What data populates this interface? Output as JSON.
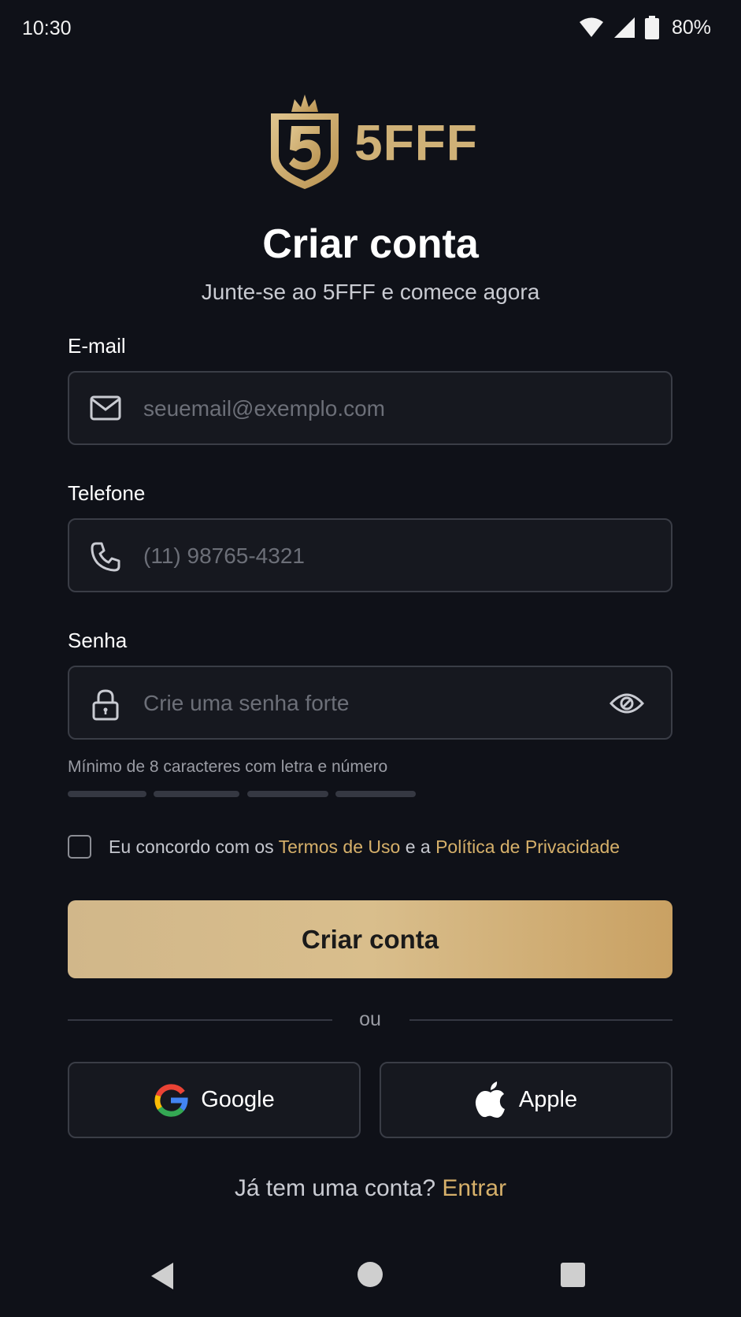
{
  "status": {
    "time": "10:30",
    "battery": "80%"
  },
  "brand": {
    "name": "5FFF",
    "accent": "#cfb177",
    "link_color": "#d6b06a"
  },
  "page": {
    "title": "Criar conta",
    "subtitle": "Junte-se ao 5FFF e comece agora"
  },
  "form": {
    "email": {
      "label": "E-mail",
      "placeholder": "seuemail@exemplo.com",
      "icon": "mail-icon"
    },
    "phone": {
      "label": "Telefone",
      "placeholder": "(11) 98765-4321",
      "icon": "phone-icon"
    },
    "password": {
      "label": "Senha",
      "placeholder": "Crie uma senha forte",
      "icon": "lock-icon",
      "toggle_icon": "eye-icon"
    },
    "password_hint": "Mínimo de 8 caracteres com letra e número",
    "strength_segments_filled": 0,
    "terms": {
      "prefix": "Eu concordo com os ",
      "terms_link": "Termos de Uso",
      "middle": " e a ",
      "privacy_link": "Política de Privacidade",
      "checked": false
    },
    "submit_label": "Criar conta"
  },
  "divider_text": "ou",
  "social": {
    "google_label": "Google",
    "apple_label": "Apple"
  },
  "footer": {
    "question": "Já tem uma conta? ",
    "login_link": "Entrar"
  }
}
